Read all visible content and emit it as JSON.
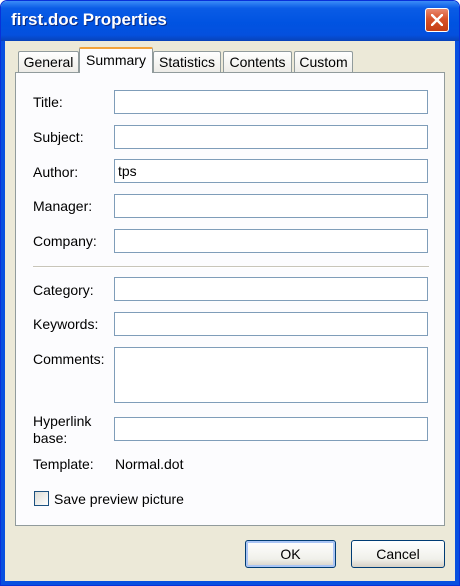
{
  "window": {
    "title": "first.doc Properties",
    "close_icon": "close-icon"
  },
  "tabs": [
    {
      "label": "General",
      "active": false
    },
    {
      "label": "Summary",
      "active": true
    },
    {
      "label": "Statistics",
      "active": false
    },
    {
      "label": "Contents",
      "active": false
    },
    {
      "label": "Custom",
      "active": false
    }
  ],
  "fields": {
    "title": {
      "label": "Title:",
      "value": ""
    },
    "subject": {
      "label": "Subject:",
      "value": ""
    },
    "author": {
      "label": "Author:",
      "value": "tps"
    },
    "manager": {
      "label": "Manager:",
      "value": ""
    },
    "company": {
      "label": "Company:",
      "value": ""
    },
    "category": {
      "label": "Category:",
      "value": ""
    },
    "keywords": {
      "label": "Keywords:",
      "value": ""
    },
    "comments": {
      "label": "Comments:",
      "value": ""
    },
    "hyperlink_base": {
      "label_line1": "Hyperlink",
      "label_line2": "base:",
      "value": ""
    }
  },
  "template": {
    "label": "Template:",
    "value": "Normal.dot"
  },
  "save_preview": {
    "label": "Save preview picture",
    "checked": false
  },
  "buttons": {
    "ok": "OK",
    "cancel": "Cancel"
  },
  "colors": {
    "titlebar": "#0053e1",
    "close_button": "#d8522a",
    "dialog_bg": "#ece9d8",
    "active_tab_accent": "#f2a33a"
  }
}
